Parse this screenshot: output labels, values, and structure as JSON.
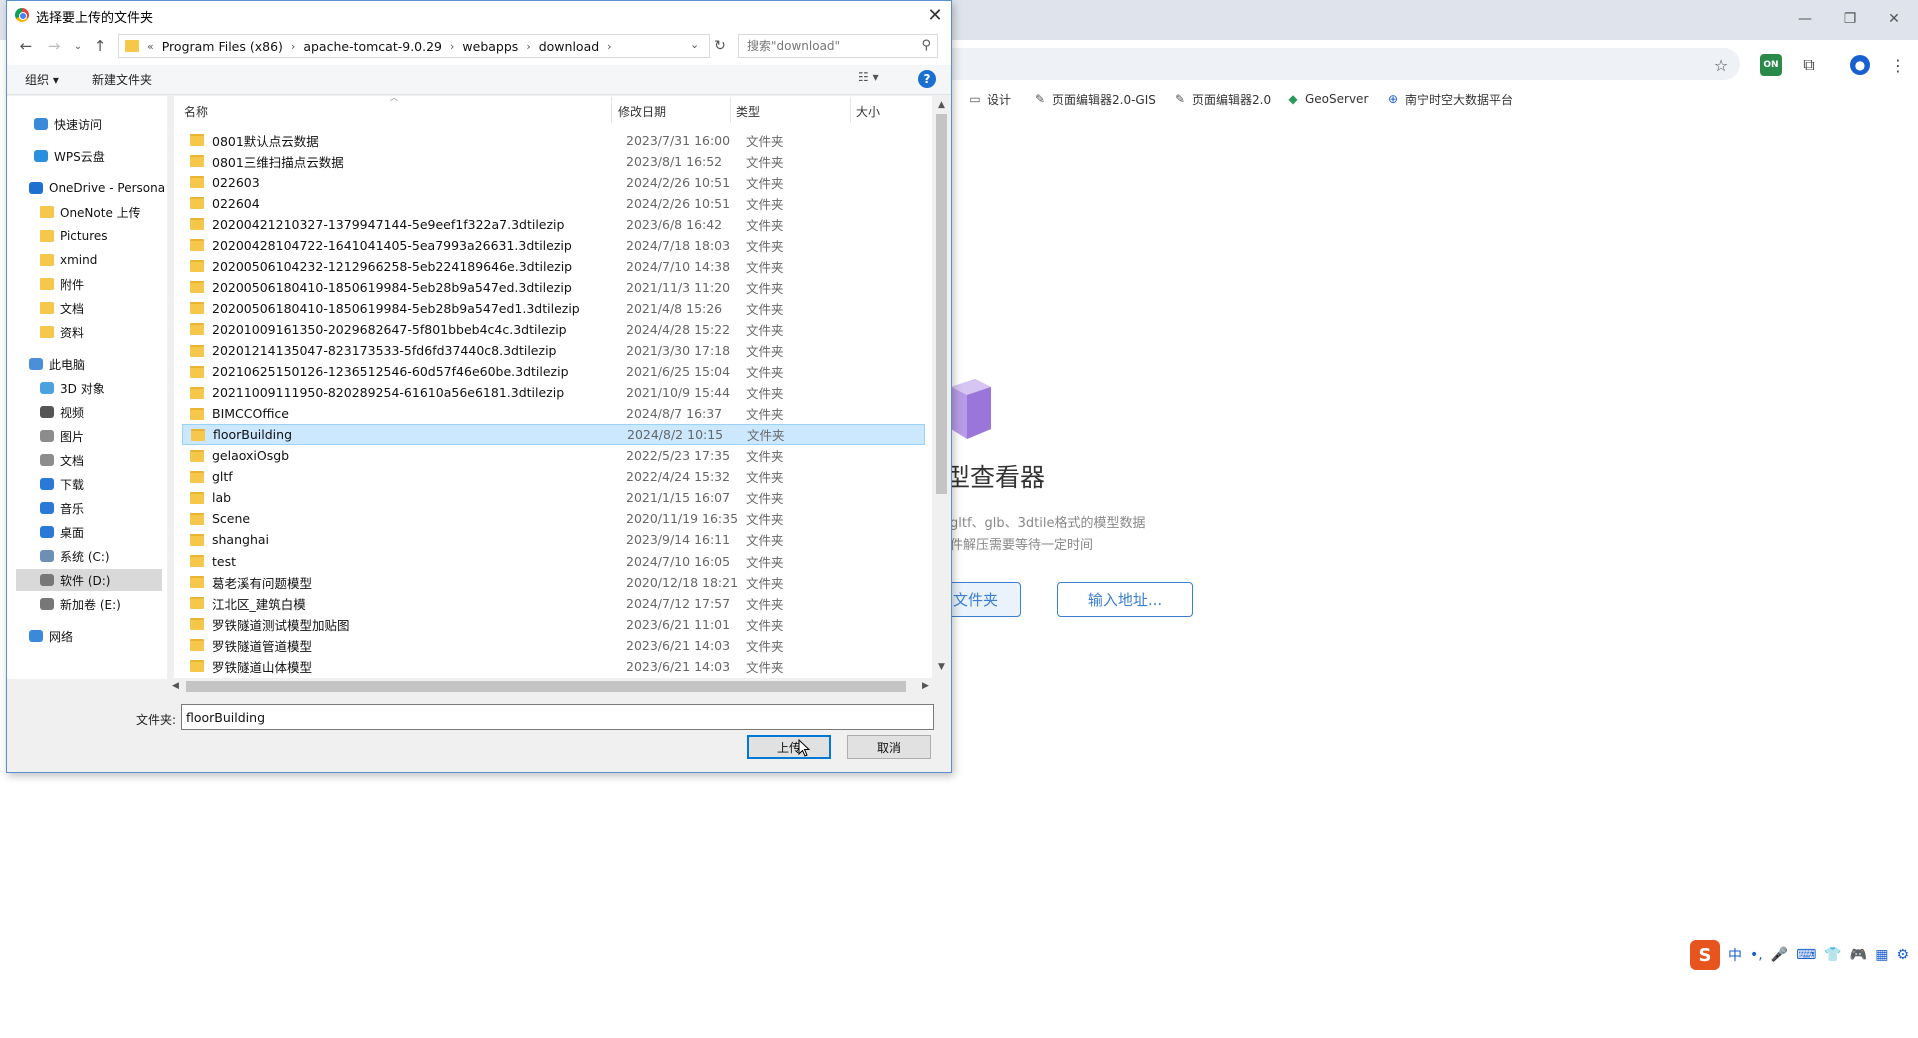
{
  "dialog": {
    "title": "选择要上传的文件夹",
    "path": [
      "Program Files (x86)",
      "apache-tomcat-9.0.29",
      "webapps",
      "download"
    ],
    "path_overflow": "«",
    "search_placeholder": "搜索\"download\"",
    "organize_label": "组织 ▾",
    "new_folder_label": "新建文件夹",
    "columns": {
      "name": "名称",
      "date": "修改日期",
      "type": "类型",
      "size": "大小"
    },
    "sidebar": [
      {
        "label": "快速访问",
        "icon": "star-icon",
        "color": "#3b8ad9"
      },
      {
        "label": "WPS云盘",
        "icon": "cloud-icon",
        "color": "#2b8fe0"
      },
      {
        "label": "OneDrive - Persona",
        "icon": "onedrive-icon",
        "color": "#1e6fd0"
      },
      {
        "label": "OneNote 上传",
        "icon": "folder-icon",
        "color": "#f5c84c"
      },
      {
        "label": "Pictures",
        "icon": "folder-icon",
        "color": "#f5c84c"
      },
      {
        "label": "xmind",
        "icon": "folder-icon",
        "color": "#f5c84c"
      },
      {
        "label": "附件",
        "icon": "folder-icon",
        "color": "#f5c84c"
      },
      {
        "label": "文档",
        "icon": "folder-icon",
        "color": "#f5c84c"
      },
      {
        "label": "资料",
        "icon": "folder-icon",
        "color": "#f5c84c"
      },
      {
        "label": "此电脑",
        "icon": "computer-icon",
        "color": "#4a90d9"
      },
      {
        "label": "3D 对象",
        "icon": "cube-icon",
        "color": "#4aa3df"
      },
      {
        "label": "视频",
        "icon": "video-icon",
        "color": "#555555"
      },
      {
        "label": "图片",
        "icon": "picture-icon",
        "color": "#8c8c8c"
      },
      {
        "label": "文档",
        "icon": "document-icon",
        "color": "#8c8c8c"
      },
      {
        "label": "下载",
        "icon": "download-icon",
        "color": "#2b79d6"
      },
      {
        "label": "音乐",
        "icon": "music-icon",
        "color": "#2b79d6"
      },
      {
        "label": "桌面",
        "icon": "desktop-icon",
        "color": "#2b79d6"
      },
      {
        "label": "系统 (C:)",
        "icon": "drive-c-icon",
        "color": "#6b8fb5"
      },
      {
        "label": "软件 (D:)",
        "icon": "drive-icon",
        "color": "#777777"
      },
      {
        "label": "新加卷 (E:)",
        "icon": "drive-icon",
        "color": "#777777"
      },
      {
        "label": "网络",
        "icon": "network-icon",
        "color": "#3b8ad9"
      }
    ],
    "files": [
      {
        "name": "0801默认点云数据",
        "date": "2023/7/31 16:00",
        "type": "文件夹"
      },
      {
        "name": "0801三维扫描点云数据",
        "date": "2023/8/1 16:52",
        "type": "文件夹"
      },
      {
        "name": "022603",
        "date": "2024/2/26 10:51",
        "type": "文件夹"
      },
      {
        "name": "022604",
        "date": "2024/2/26 10:51",
        "type": "文件夹"
      },
      {
        "name": "20200421210327-1379947144-5e9eef1f322a7.3dtilezip",
        "date": "2023/6/8 16:42",
        "type": "文件夹"
      },
      {
        "name": "20200428104722-1641041405-5ea7993a26631.3dtilezip",
        "date": "2024/7/18 18:03",
        "type": "文件夹"
      },
      {
        "name": "20200506104232-1212966258-5eb224189646e.3dtilezip",
        "date": "2024/7/10 14:38",
        "type": "文件夹"
      },
      {
        "name": "20200506180410-1850619984-5eb28b9a547ed.3dtilezip",
        "date": "2021/11/3 11:20",
        "type": "文件夹"
      },
      {
        "name": "20200506180410-1850619984-5eb28b9a547ed1.3dtilezip",
        "date": "2021/4/8 15:26",
        "type": "文件夹"
      },
      {
        "name": "20201009161350-2029682647-5f801bbeb4c4c.3dtilezip",
        "date": "2024/4/28 15:22",
        "type": "文件夹"
      },
      {
        "name": "20201214135047-823173533-5fd6fd37440c8.3dtilezip",
        "date": "2021/3/30 17:18",
        "type": "文件夹"
      },
      {
        "name": "20210625150126-1236512546-60d57f46e60be.3dtilezip",
        "date": "2021/6/25 15:04",
        "type": "文件夹"
      },
      {
        "name": "20211009111950-820289254-61610a56e6181.3dtilezip",
        "date": "2021/10/9 15:44",
        "type": "文件夹"
      },
      {
        "name": "BIMCCOffice",
        "date": "2024/8/7 16:37",
        "type": "文件夹"
      },
      {
        "name": "floorBuilding",
        "date": "2024/8/2 10:15",
        "type": "文件夹"
      },
      {
        "name": "gelaoxiOsgb",
        "date": "2022/5/23 17:35",
        "type": "文件夹"
      },
      {
        "name": "gltf",
        "date": "2022/4/24 15:32",
        "type": "文件夹"
      },
      {
        "name": "lab",
        "date": "2021/1/15 16:07",
        "type": "文件夹"
      },
      {
        "name": "Scene",
        "date": "2020/11/19 16:35",
        "type": "文件夹"
      },
      {
        "name": "shanghai",
        "date": "2023/9/14 16:11",
        "type": "文件夹"
      },
      {
        "name": "test",
        "date": "2024/7/10 16:05",
        "type": "文件夹"
      },
      {
        "name": "葛老溪有问题模型",
        "date": "2020/12/18 18:21",
        "type": "文件夹"
      },
      {
        "name": "江北区_建筑白模",
        "date": "2024/7/12 17:57",
        "type": "文件夹"
      },
      {
        "name": "罗铁隧道测试模型加贴图",
        "date": "2023/6/21 11:01",
        "type": "文件夹"
      },
      {
        "name": "罗铁隧道管道模型",
        "date": "2023/6/21 14:03",
        "type": "文件夹"
      },
      {
        "name": "罗铁隧道山体模型",
        "date": "2023/6/21 14:03",
        "type": "文件夹"
      }
    ],
    "folder_field_label": "文件夹:",
    "folder_field_value": "floorBuilding",
    "ok_label": "上传",
    "cancel_label": "取消"
  },
  "browser": {
    "bookmarks": [
      "设计",
      "页面编辑器2.0-GIS",
      "页面编辑器2.0",
      "GeoServer",
      "南宁时空大数据平台"
    ],
    "app_title": "型查看器",
    "app_subtitle_1": "gltf、glb、3dtile格式的模型数据",
    "app_subtitle_2": "件解压需要等待一定时间",
    "btn_folder": "文件夹",
    "btn_address": "输入地址..."
  },
  "ime": [
    "中",
    "•,",
    "🎤",
    "⌨",
    "👕",
    "🎮",
    "▦",
    "⚙"
  ],
  "colors": {
    "accent": "#0078d7",
    "selection": "#cce8ff",
    "folder": "#f5c84c",
    "app_button": "#3b7fd1"
  }
}
